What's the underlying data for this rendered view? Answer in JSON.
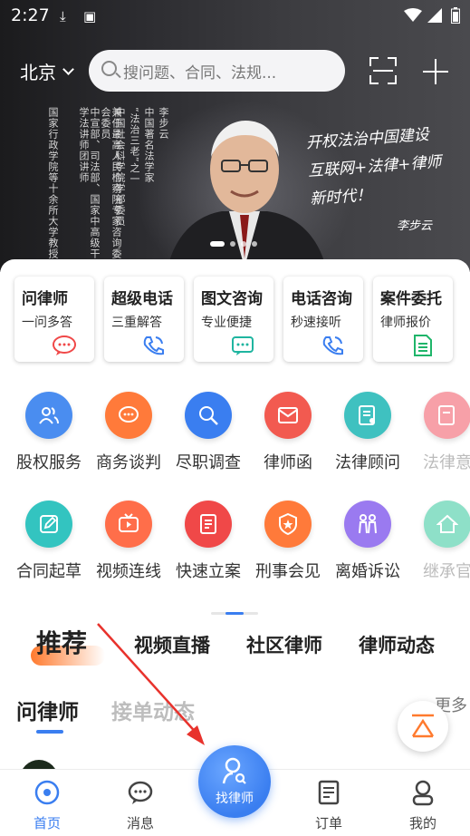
{
  "status_bar": {
    "time": "2:27"
  },
  "header": {
    "city": "北京",
    "search_placeholder": "搜问题、合同、法规..."
  },
  "banner": {
    "vertical_text_columns": [
      "李步云",
      "中国著名法学家",
      "“法治三老”之一",
      "中国社会科学院学部委员",
      "兼任最高人民检察院专家咨询委员会委员",
      "中宣部、司法部、国家中高级干部学法讲师团讲师",
      "国家行政学院等十余所大学教授。"
    ],
    "calligraphy_lines": [
      "开权法治中国建设",
      "互联网+法律+律师",
      "新时代！"
    ],
    "signature": "李步云",
    "slide_count": 4,
    "active_slide": 0
  },
  "services": [
    {
      "title": "问律师",
      "subtitle": "一问多答",
      "icon": "chat-bubble-icon",
      "icon_color": "#f04848"
    },
    {
      "title": "超级电话",
      "subtitle": "三重解答",
      "icon": "phone-call-icon",
      "icon_color": "#3a7ef0"
    },
    {
      "title": "图文咨询",
      "subtitle": "专业便捷",
      "icon": "message-box-icon",
      "icon_color": "#1fb5a0"
    },
    {
      "title": "电话咨询",
      "subtitle": "秒速接听",
      "icon": "phone-call-icon",
      "icon_color": "#3a7ef0"
    },
    {
      "title": "案件委托",
      "subtitle": "律师报价",
      "icon": "document-icon",
      "icon_color": "#1fb56a"
    }
  ],
  "grid_row1": [
    {
      "label": "股权服务",
      "icon": "people-icon",
      "color": "#4a8df0"
    },
    {
      "label": "商务谈判",
      "icon": "chat-dots-icon",
      "color": "#ff7a3a"
    },
    {
      "label": "尽职调查",
      "icon": "magnifier-icon",
      "color": "#3a7ef0"
    },
    {
      "label": "律师函",
      "icon": "envelope-icon",
      "color": "#f25a50"
    },
    {
      "label": "法律顾问",
      "icon": "contract-icon",
      "color": "#3fc1c0"
    },
    {
      "label": "法律意",
      "icon": "legal-opinion-icon",
      "color": "#f7a0a8"
    }
  ],
  "grid_row2": [
    {
      "label": "合同起草",
      "icon": "edit-icon",
      "color": "#33c4c0"
    },
    {
      "label": "视频连线",
      "icon": "tv-play-icon",
      "color": "#ff6e4a"
    },
    {
      "label": "快速立案",
      "icon": "file-icon",
      "color": "#f04848"
    },
    {
      "label": "刑事会见",
      "icon": "badge-star-icon",
      "color": "#ff7a3a"
    },
    {
      "label": "离婚诉讼",
      "icon": "couple-icon",
      "color": "#9a7af0"
    },
    {
      "label": "继承官",
      "icon": "house-icon",
      "color": "#8ee0c8"
    }
  ],
  "feed_tabs": [
    "推荐",
    "视频直播",
    "社区律师",
    "律师动态"
  ],
  "active_feed_tab": 0,
  "sub_tabs": [
    "问律师",
    "接单动态"
  ],
  "more_label": "更多",
  "bottom_nav": [
    {
      "label": "首页",
      "icon": "home-compass-icon",
      "active": true
    },
    {
      "label": "消息",
      "icon": "chat-icon",
      "active": false
    },
    {
      "label": "找律师",
      "icon": "find-lawyer-icon",
      "active": false
    },
    {
      "label": "订单",
      "icon": "order-icon",
      "active": false
    },
    {
      "label": "我的",
      "icon": "user-icon",
      "active": false
    }
  ],
  "colors": {
    "accent": "#3a7ef0",
    "highlight": "#ff7a2e",
    "annotation_arrow": "#e8322c"
  }
}
